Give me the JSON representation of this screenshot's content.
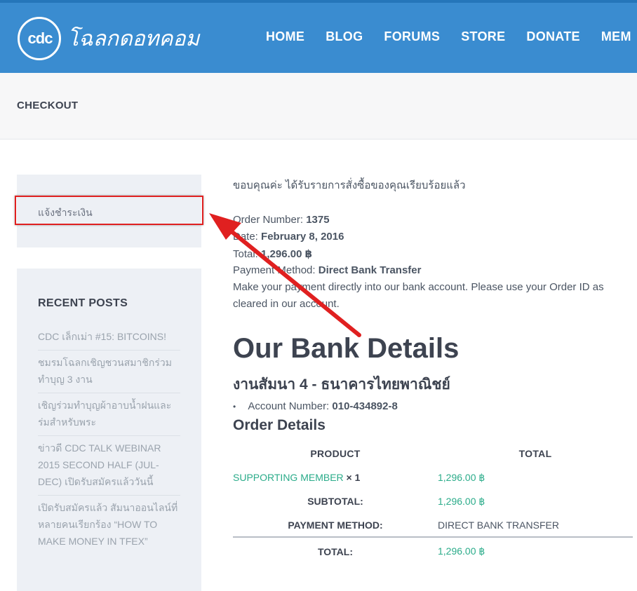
{
  "header": {
    "logo_text": "cdc",
    "logo_script": "โฉลกดอทคอม",
    "nav": [
      "HOME",
      "BLOG",
      "FORUMS",
      "STORE",
      "DONATE",
      "MEM"
    ]
  },
  "page": {
    "title": "CHECKOUT"
  },
  "sidebar": {
    "payment_link": "แจ้งชำระเงิน",
    "recent_posts_title": "RECENT POSTS",
    "recent_posts": [
      "CDC เล็กเม่า #15: BITCOINS!",
      "ชมรมโฉลกเชิญชวนสมาชิกร่วมทำบุญ 3 งาน",
      "เชิญร่วมทำบุญผ้าอาบน้ำฝนและร่มสำหรับพระ",
      "ข่าวดี CDC TALK WEBINAR 2015 SECOND HALF (JUL-DEC) เปิดรับสมัครแล้ววันนี้",
      "เปิดรับสมัครแล้ว สัมนาออนไลน์ที่หลายคนเรียกร้อง “HOW TO MAKE MONEY IN TFEX”"
    ]
  },
  "order": {
    "thanks": "ขอบคุณค่ะ ได้รับรายการสั่งซื้อของคุณเรียบร้อยแล้ว",
    "number_label": "Order Number:",
    "number": "1375",
    "date_label": "Date:",
    "date": "February 8, 2016",
    "total_label": "Total:",
    "total": "1,296.00 ฿",
    "method_label": "Payment Method:",
    "method": "Direct Bank Transfer",
    "instructions_1": "Make your payment directly into our bank account. Please use your Order ID as",
    "instructions_2": "cleared in our account."
  },
  "bank": {
    "title": "Our Bank Details",
    "subtitle": "งานสัมนา 4 - ธนาคารไทยพาณิชย์",
    "account_label": "Account Number:",
    "account_number": "010-434892-8"
  },
  "order_details": {
    "title": "Order Details",
    "col_product": "PRODUCT",
    "col_total": "TOTAL",
    "product_name": "SUPPORTING MEMBER",
    "product_qty": "× 1",
    "product_total": "1,296.00 ฿",
    "subtotal_label": "SUBTOTAL:",
    "subtotal": "1,296.00 ฿",
    "payment_label": "PAYMENT METHOD:",
    "payment_value": "DIRECT BANK TRANSFER",
    "total_label": "TOTAL:",
    "total": "1,296.00 ฿"
  },
  "colors": {
    "header_blue": "#3a8cd0",
    "accent_green": "#2bac8a",
    "annotation_red": "#e02020"
  }
}
